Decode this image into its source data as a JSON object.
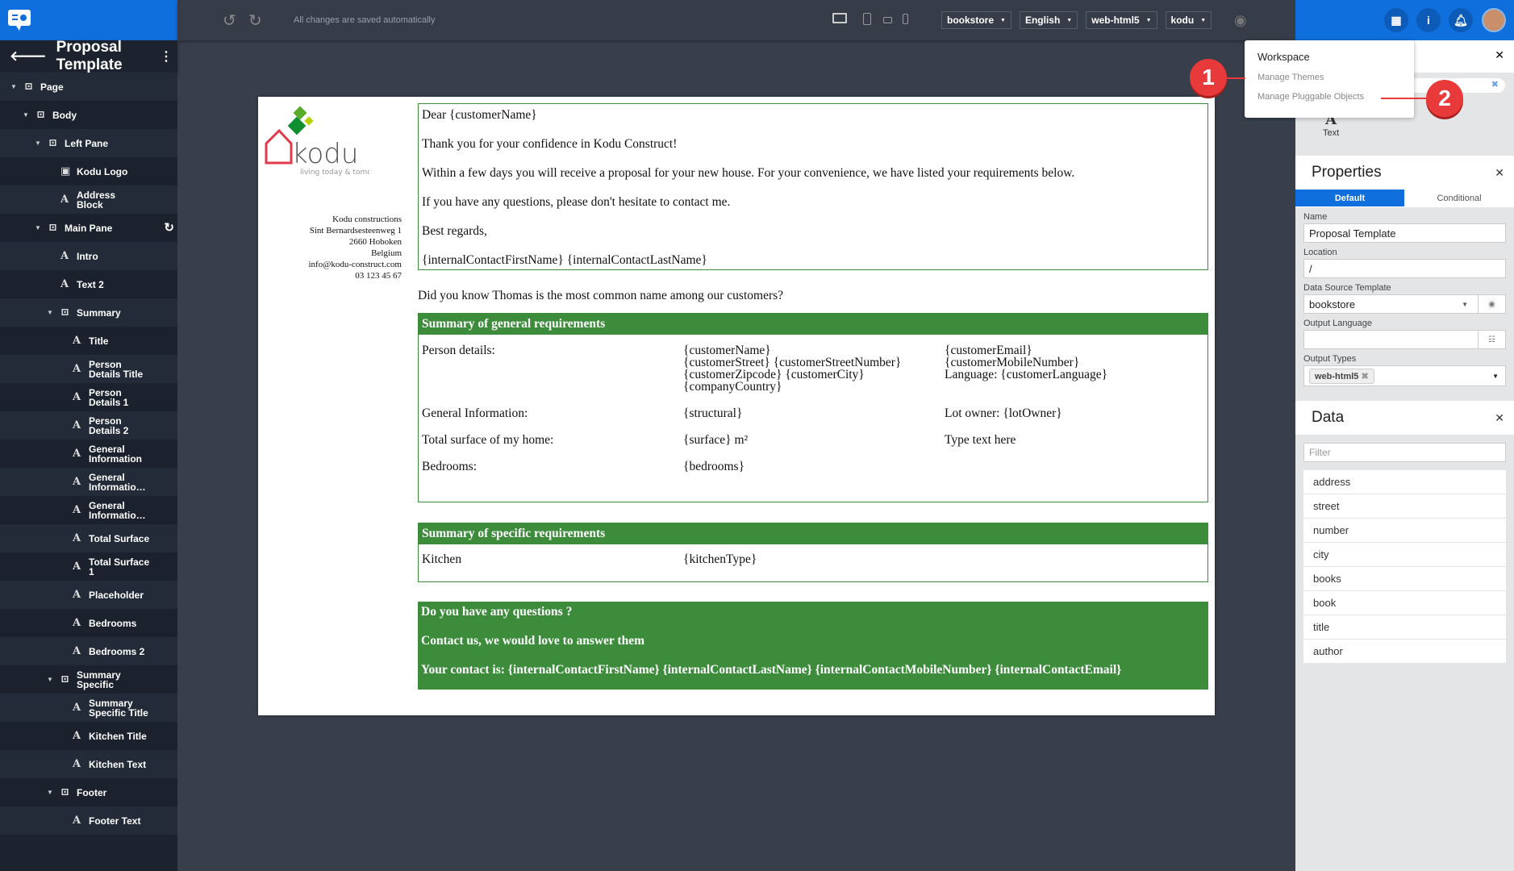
{
  "toolbar": {
    "status": "All changes are saved automatically",
    "selects": [
      "bookstore",
      "English",
      "web-html5",
      "kodu"
    ]
  },
  "sidebar": {
    "title": "Proposal Template",
    "items": [
      {
        "label": "Page",
        "depth": 0,
        "type": "container",
        "expanded": true
      },
      {
        "label": "Body",
        "depth": 1,
        "type": "container",
        "expanded": true
      },
      {
        "label": "Left Pane",
        "depth": 2,
        "type": "container",
        "expanded": true
      },
      {
        "label": "Kodu Logo",
        "depth": 3,
        "type": "image"
      },
      {
        "label": "Address Block",
        "depth": 3,
        "type": "text"
      },
      {
        "label": "Main Pane",
        "depth": 2,
        "type": "container",
        "expanded": true
      },
      {
        "label": "Intro",
        "depth": 3,
        "type": "text"
      },
      {
        "label": "Text 2",
        "depth": 3,
        "type": "text"
      },
      {
        "label": "Summary",
        "depth": 3,
        "type": "container",
        "expanded": true
      },
      {
        "label": "Title",
        "depth": 4,
        "type": "text"
      },
      {
        "label": "Person Details Title",
        "depth": 4,
        "type": "text"
      },
      {
        "label": "Person Details 1",
        "depth": 4,
        "type": "text"
      },
      {
        "label": "Person Details 2",
        "depth": 4,
        "type": "text"
      },
      {
        "label": "General Information",
        "depth": 4,
        "type": "text"
      },
      {
        "label": "General Informatio…",
        "depth": 4,
        "type": "text"
      },
      {
        "label": "General Informatio…",
        "depth": 4,
        "type": "text"
      },
      {
        "label": "Total Surface",
        "depth": 4,
        "type": "text"
      },
      {
        "label": "Total Surface 1",
        "depth": 4,
        "type": "text"
      },
      {
        "label": "Placeholder",
        "depth": 4,
        "type": "text"
      },
      {
        "label": "Bedrooms",
        "depth": 4,
        "type": "text"
      },
      {
        "label": "Bedrooms 2",
        "depth": 4,
        "type": "text"
      },
      {
        "label": "Summary Specific",
        "depth": 3,
        "type": "container",
        "expanded": true
      },
      {
        "label": "Summary Specific Title",
        "depth": 4,
        "type": "text"
      },
      {
        "label": "Kitchen Title",
        "depth": 4,
        "type": "text"
      },
      {
        "label": "Kitchen Text",
        "depth": 4,
        "type": "text"
      },
      {
        "label": "Footer",
        "depth": 3,
        "type": "container",
        "expanded": true
      },
      {
        "label": "Footer Text",
        "depth": 4,
        "type": "text"
      }
    ]
  },
  "document": {
    "logo": {
      "name": "kodu",
      "tagline": "living today & tomorrow"
    },
    "address": [
      "Kodu constructions",
      "Sint Bernardsesteenweg 1",
      "2660 Hoboken",
      "Belgium",
      "info@kodu-construct.com",
      "03 123 45 67"
    ],
    "intro": [
      "Dear {customerName}",
      "Thank you for your confidence in Kodu Construct!",
      "Within a few days you will receive a proposal for your new house. For your convenience, we have listed your requirements below.",
      "If you have any questions, please don't hesitate to contact me.",
      "Best regards,",
      "{internalContactFirstName} {internalContactLastName}"
    ],
    "did_you_know": "Did you know Thomas is the most common name among our customers?",
    "general": {
      "title": "Summary of general requirements",
      "rows": [
        [
          "Person details:",
          "{customerName}\n{customerStreet} {customerStreetNumber}\n{customerZipcode} {customerCity}\n{companyCountry}",
          "{customerEmail}\n{customerMobileNumber}\nLanguage: {customerLanguage}"
        ],
        [
          "General Information:",
          "{structural}",
          "Lot owner: {lotOwner}"
        ],
        [
          "Total surface of my home:",
          "{surface} m²",
          "Type text here"
        ],
        [
          "Bedrooms:",
          "{bedrooms}",
          ""
        ]
      ]
    },
    "specific": {
      "title": "Summary of specific requirements",
      "rows": [
        [
          "Kitchen",
          "{kitchenType}"
        ]
      ]
    },
    "footer": [
      "Do you have any questions ?",
      "Contact us, we would love to answer them",
      "Your contact is: {internalContactFirstName} {internalContactLastName} {internalContactMobileNumber} {internalContactEmail}"
    ]
  },
  "menu": {
    "title": "Workspace",
    "items": [
      "Manage Themes",
      "Manage Pluggable Objects"
    ]
  },
  "annotations": [
    "1",
    "2"
  ],
  "widget": {
    "label": "Text"
  },
  "properties": {
    "title": "Properties",
    "tabs": [
      "Default",
      "Conditional"
    ],
    "name_label": "Name",
    "name": "Proposal Template",
    "location_label": "Location",
    "location": "/",
    "ds_label": "Data Source Template",
    "ds": "bookstore",
    "lang_label": "Output Language",
    "lang": "",
    "types_label": "Output Types",
    "types": [
      "web-html5"
    ]
  },
  "data": {
    "title": "Data",
    "filter_placeholder": "Filter",
    "items": [
      "address",
      "street",
      "number",
      "city",
      "books",
      "book",
      "title",
      "author"
    ]
  },
  "colors": {
    "accent": "#0f6fdc",
    "green": "#3d8c3c",
    "badge": "#e83a3a"
  }
}
